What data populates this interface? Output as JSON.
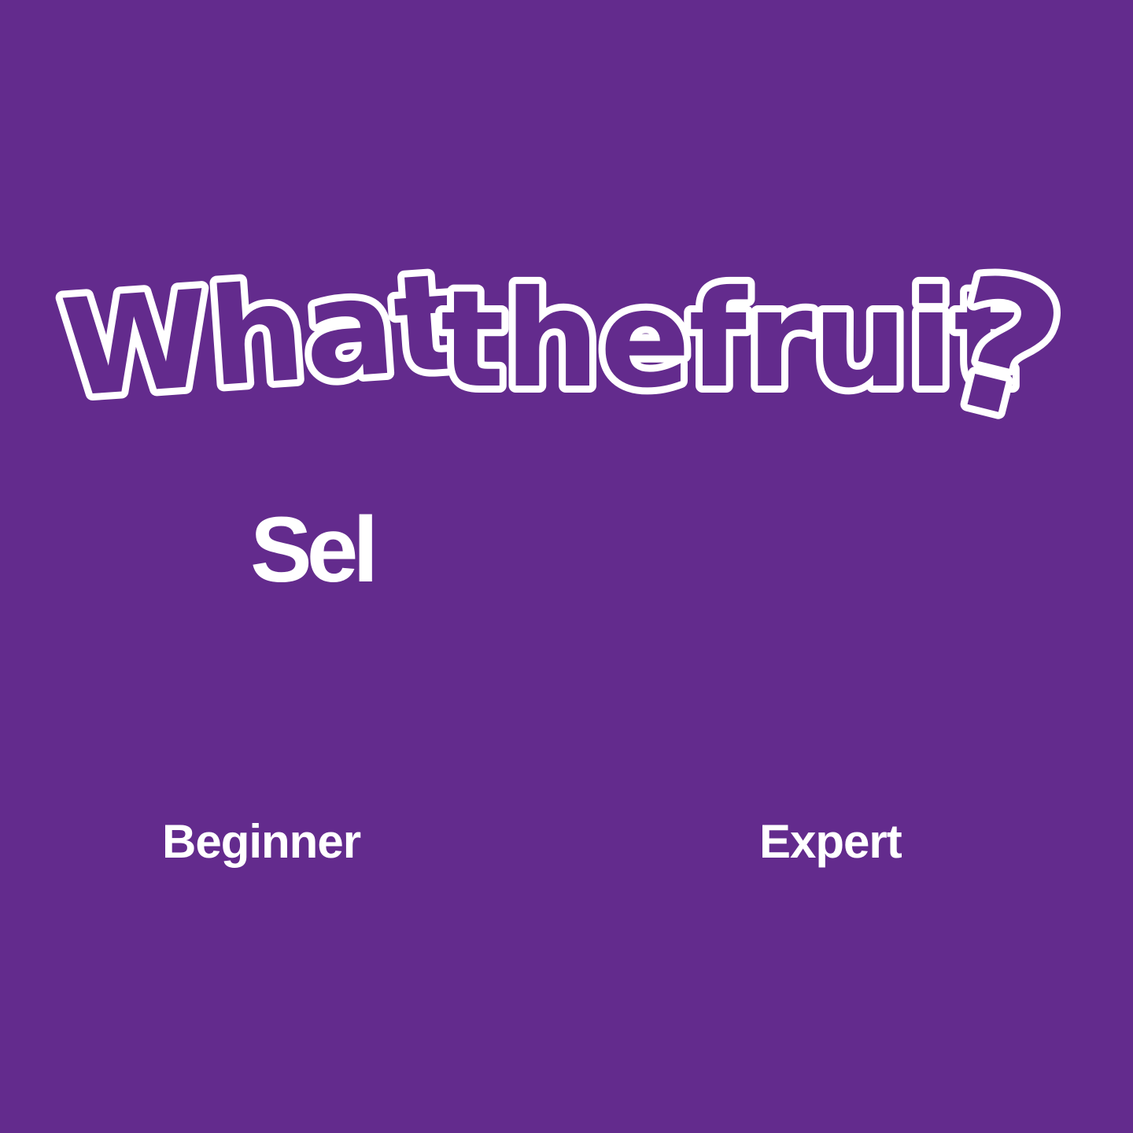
{
  "screen": {
    "background_color": "#632b8d",
    "text_color": "#ffffff"
  },
  "title": {
    "text": "What the fruit?",
    "words": [
      "What",
      "the",
      "fruit",
      "?"
    ]
  },
  "prompt": {
    "text": "Sel"
  },
  "levels": [
    {
      "label": "Beginner"
    },
    {
      "label": "Expert"
    }
  ]
}
